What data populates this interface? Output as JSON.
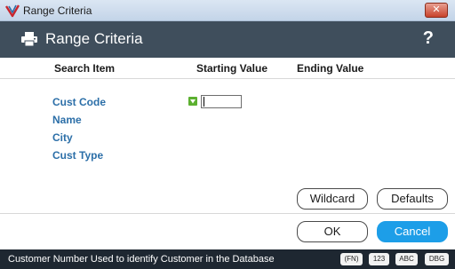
{
  "window": {
    "title": "Range Criteria",
    "close_glyph": "✕"
  },
  "header": {
    "title": "Range Criteria",
    "help_label": "?"
  },
  "columns": {
    "search_item": "Search Item",
    "starting_value": "Starting Value",
    "ending_value": "Ending Value"
  },
  "fields": [
    {
      "label": "Cust Code"
    },
    {
      "label": "Name"
    },
    {
      "label": "City"
    },
    {
      "label": "Cust Type"
    }
  ],
  "inputs": {
    "cust_code_start": ""
  },
  "buttons": {
    "wildcard": "Wildcard",
    "defaults": "Defaults",
    "ok": "OK",
    "cancel": "Cancel"
  },
  "status": {
    "text": "Customer Number  Used to identify Customer in the Database",
    "keys": [
      "(FN)",
      "123",
      "ABC",
      "DBG"
    ]
  },
  "colors": {
    "header_bg": "#3f4e5c",
    "field_label": "#2c6fa8",
    "cancel_bg": "#1d9ee8",
    "status_bg": "#1e2731",
    "lookup_icon": "#5cb030"
  },
  "icons": {
    "app": "app-logo-icon",
    "header": "printer-icon",
    "lookup": "dropdown-lookup-icon"
  }
}
